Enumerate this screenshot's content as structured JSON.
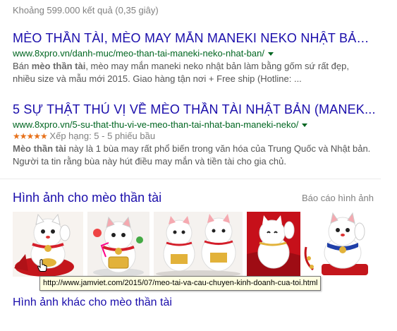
{
  "search": {
    "stats": "Khoảng 599.000 kết quả (0,35 giây)"
  },
  "results": [
    {
      "title": "MÈO THẦN TÀI, MÈO MAY MẮN MANEKI NEKO NHẬT BẢN...",
      "url": "www.8xpro.vn/danh-muc/meo-than-tai-maneki-neko-nhat-ban/",
      "snippet_line1_pre": "Bán ",
      "snippet_line1_bold": "mèo thần tài",
      "snippet_line1_post": ", mèo may mắn maneki neko nhật bản làm bằng gốm sứ rất đẹp,",
      "snippet_line2": "nhiều size và mẫu mới 2015. Giao hàng tận nơi + Free ship (Hotline: ..."
    },
    {
      "title": "5 SỰ THẬT THÚ VỊ VỀ MÈO THẦN TÀI NHẬT BẢN (MANEK...",
      "url": "www.8xpro.vn/5-su-that-thu-vi-ve-meo-than-tai-nhat-ban-maneki-neko/",
      "stars": "★★★★★",
      "rating": "Xếp hạng: 5 - 5 phiếu bầu",
      "snippet_line1_bold": "Mèo thần tài",
      "snippet_line1_post": " này là 1 bùa may rất phổ biến trong văn hóa của Trung Quốc và Nhật bản.",
      "snippet_line2": "Người ta tin rằng bùa này hút điều may mắn và tiền tài cho gia chủ."
    }
  ],
  "images": {
    "heading": "Hình ảnh cho mèo thần tài",
    "report": "Báo cáo hình ảnh",
    "more": "Hình ảnh khác cho mèo thần tài",
    "thumbnails": [
      {
        "name": "maneki-neko-red-cushion"
      },
      {
        "name": "maneki-neko-gold-coin"
      },
      {
        "name": "maneki-neko-pair"
      },
      {
        "name": "maneki-neko-red-fabric"
      },
      {
        "name": "maneki-neko-white"
      },
      {
        "name": "maneki-neko-blue-collar"
      }
    ]
  },
  "tooltip": {
    "text": "http://www.jamviet.com/2015/07/meo-tai-va-cau-chuyen-kinh-doanh-cua-toi.html"
  },
  "colors": {
    "link": "#1a0dab",
    "url": "#006621",
    "snippet": "#545454",
    "star": "#e7711b",
    "tooltip_bg": "#ffffe1"
  }
}
